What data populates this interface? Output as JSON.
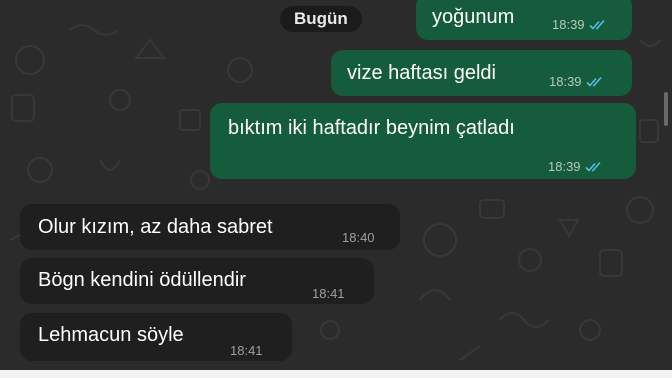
{
  "chat": {
    "date_divider": "Bugün",
    "messages": [
      {
        "direction": "outgoing",
        "text": "yoğunum",
        "time": "18:39",
        "status": "read"
      },
      {
        "direction": "outgoing",
        "text": "vize haftası geldi",
        "time": "18:39",
        "status": "read"
      },
      {
        "direction": "outgoing",
        "text": "bıktım iki haftadır beynim çatladı",
        "time": "18:39",
        "status": "read"
      },
      {
        "direction": "incoming",
        "text": "Olur kızım, az daha sabret",
        "time": "18:40"
      },
      {
        "direction": "incoming",
        "text": "Bögn kendini ödüllendir",
        "time": "18:41"
      },
      {
        "direction": "incoming",
        "text": "Lehmacun söyle",
        "time": "18:41"
      }
    ]
  },
  "colors": {
    "outgoing_bubble": "#155c3c",
    "incoming_bubble": "#1f1f1f",
    "read_ticks": "#53bdeb",
    "wallpaper": "#2b2b2b"
  },
  "icons": {
    "read_status": "double-check-icon"
  }
}
